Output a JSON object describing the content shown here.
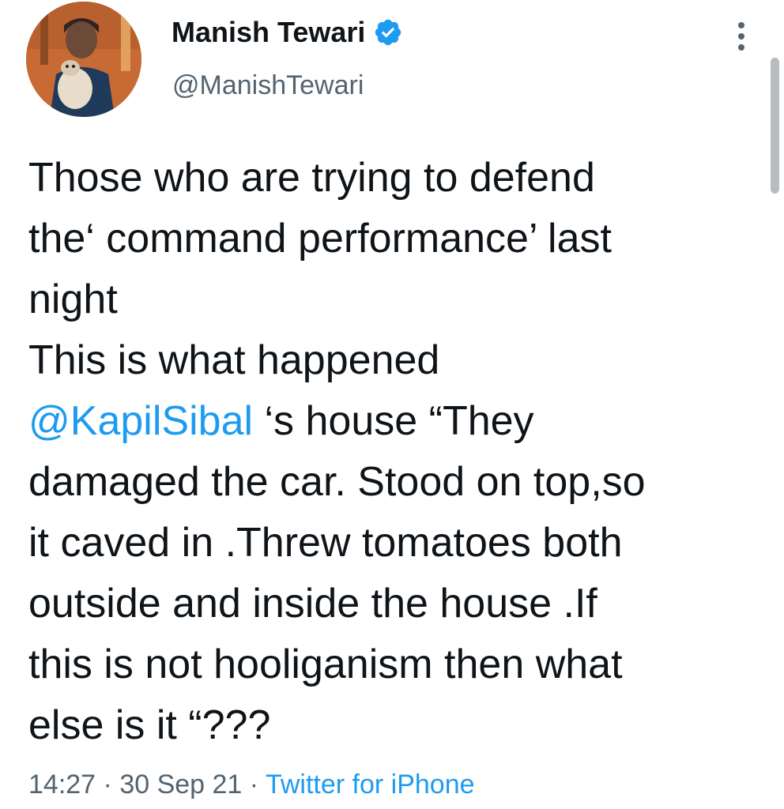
{
  "author": {
    "display_name": "Manish Tewari",
    "handle": "@ManishTewari",
    "verified_icon": "verified-badge-icon",
    "avatar_icon": "profile-photo-avatar"
  },
  "menu": {
    "icon": "more-vertical-icon"
  },
  "tweet": {
    "lines": [
      "Those who are trying to defend",
      "the‘ command performance’ last",
      "night",
      "This is what happened"
    ],
    "mention": "@KapilSibal",
    "mention_suffix": " ‘s house “They",
    "lines_after": [
      "damaged the car. Stood on top,so",
      "it caved in .Threw tomatoes both",
      "outside and inside the house .If",
      "this is not hooliganism then what",
      "else is it “???"
    ]
  },
  "meta": {
    "time": "14:27",
    "separator": " · ",
    "date": "30 Sep 21",
    "source": "Twitter for iPhone"
  },
  "colors": {
    "link": "#1d9bf0",
    "secondary_text": "#536471",
    "primary_text": "#0f1419"
  }
}
